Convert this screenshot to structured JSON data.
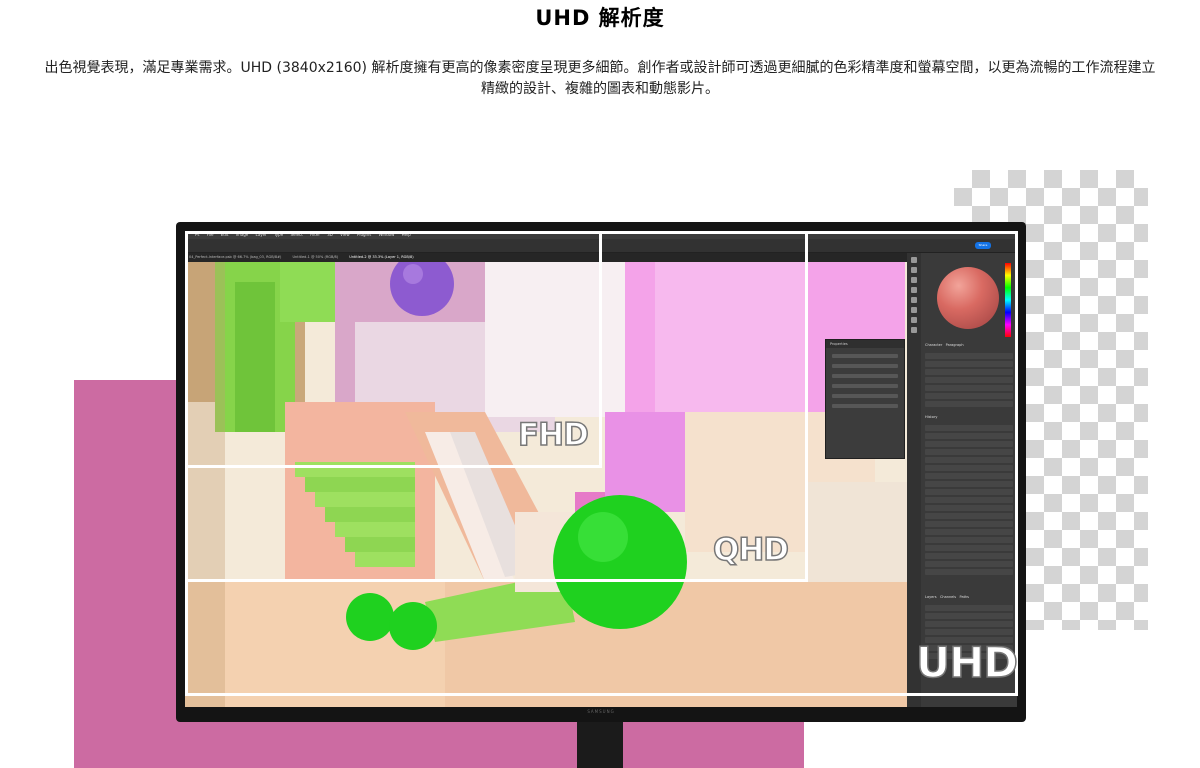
{
  "heading": "UHD 解析度",
  "description": "出色視覺表現，滿足專業需求。UHD (3840x2160) 解析度擁有更高的像素密度呈現更多細節。創作者或設計師可透過更細膩的色彩精準度和螢幕空間，以更為流暢的工作流程建立精緻的設計、複雜的圖表和動態影片。",
  "resolutions": {
    "fhd": "FHD",
    "qhd": "QHD",
    "uhd": "UHD"
  },
  "monitor": {
    "brand": "SAMSUNG"
  },
  "photoshop": {
    "menu": [
      "Ps",
      "File",
      "Edit",
      "Image",
      "Layer",
      "Type",
      "Select",
      "Filter",
      "3D",
      "View",
      "Plugins",
      "Window",
      "Help"
    ],
    "share_label": "Share",
    "tabs": [
      "04_Perfect-Interface.psb @ 66.7% (bag_03, RGB/8#)",
      "Untitled-1 @ 50% (RGB/8)",
      "Untitled-2 @ 33.3% (Layer 1, RGB/8)"
    ],
    "properties_title": "Properties",
    "character_tab": "Character",
    "paragraph_tab": "Paragraph",
    "history_tab": "History",
    "layers_tab": "Layers",
    "channels_tab": "Channels",
    "paths_tab": "Paths"
  },
  "colors": {
    "pink_panel": "#cc6ba2",
    "monitor_bezel": "#141414",
    "green_sphere": "#1fd11f",
    "purple_sphere": "#8d5bd0",
    "frame_line": "#ffffff"
  }
}
